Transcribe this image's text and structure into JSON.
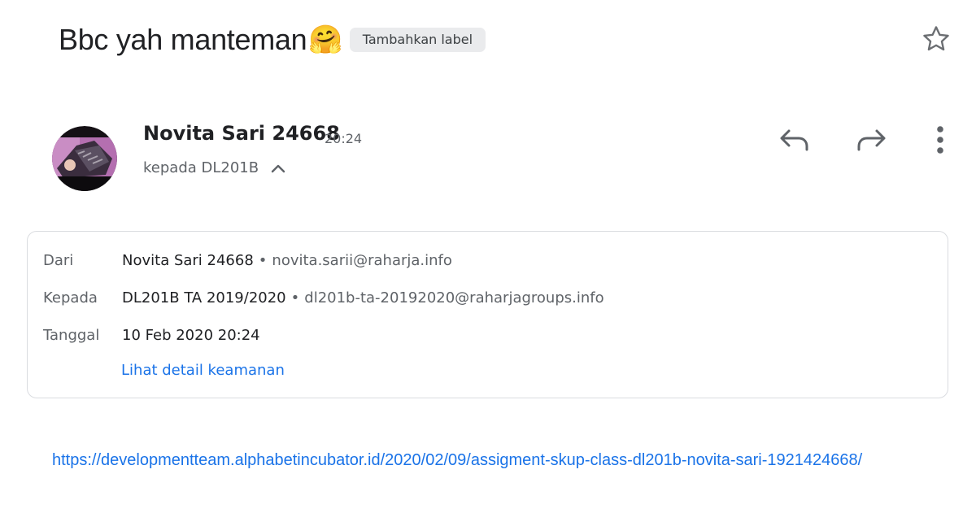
{
  "email": {
    "subject": "Bbc yah manteman",
    "subject_emoji": "🤗",
    "label_button": "Tambahkan label",
    "star_icon": "star-outline-icon"
  },
  "sender": {
    "name": "Novita Sari 24668",
    "time": "20:24",
    "recipient_summary": "kepada DL201B",
    "avatar_icon": "avatar-photo"
  },
  "actions": {
    "reply_icon": "reply-icon",
    "forward_icon": "forward-icon",
    "more_icon": "more-vert-icon"
  },
  "details": {
    "from_label": "Dari",
    "from_name": "Novita Sari 24668",
    "from_email": "novita.sarii@raharja.info",
    "to_label": "Kepada",
    "to_name": "DL201B TA 2019/2020",
    "to_email": "dl201b-ta-20192020@raharjagroups.info",
    "date_label": "Tanggal",
    "date_value": "10 Feb 2020 20:24",
    "security_link": "Lihat detail keamanan",
    "separator": "•"
  },
  "body": {
    "link": "https://developmentteam.alphabetincubator.id/2020/02/09/assigment-skup-class-dl201b-novita-sari-1921424668/"
  },
  "colors": {
    "link": "#1a73e8",
    "text_primary": "#202124",
    "text_secondary": "#5f6368",
    "card_border": "#dadce0",
    "chip_bg": "#eaebed"
  }
}
